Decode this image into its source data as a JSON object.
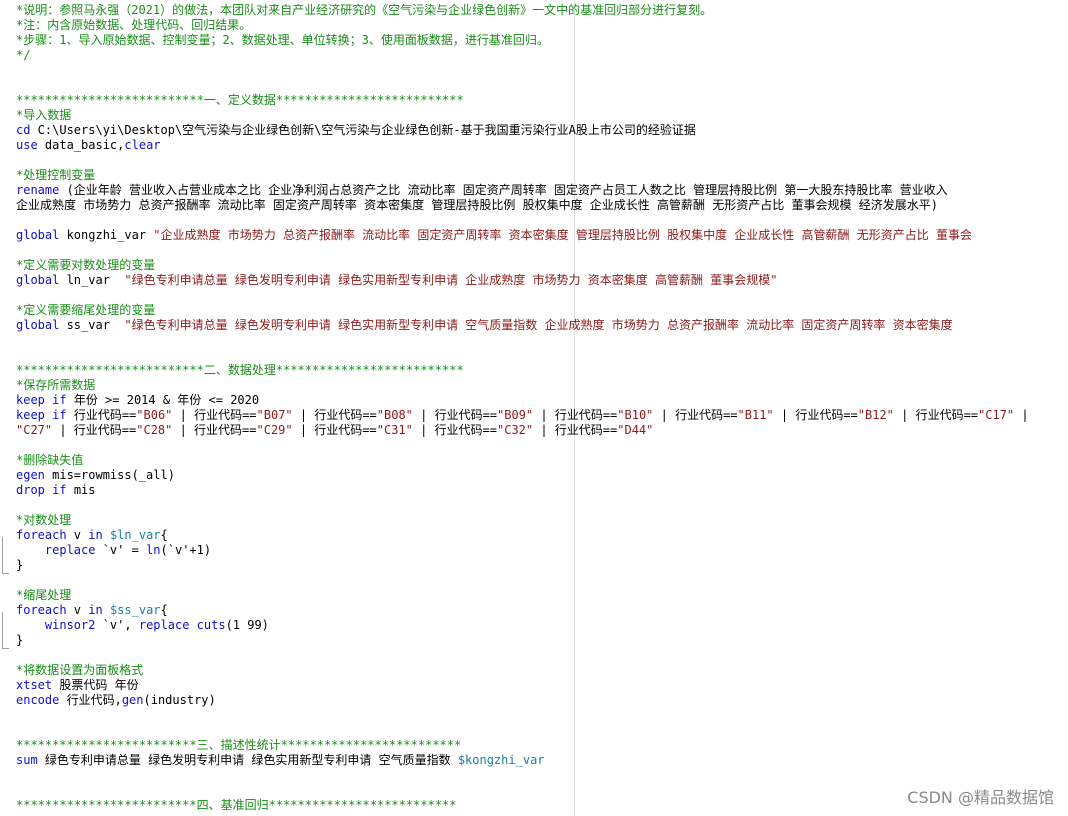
{
  "editor": {
    "lines": [
      "*说明：参照马永强（2021）的做法，本团队对来自产业经济研究的《空气污染与企业绿色创新》一文中的基准回归部分进行复刻。",
      "*注：内含原始数据、处理代码、回归结果。",
      "*步骤：1、导入原始数据、控制变量；2、数据处理、单位转换；3、使用面板数据，进行基准回归。",
      "*/",
      "",
      "",
      "**************************一、定义数据**************************",
      "*导入数据",
      "cd C:\\Users\\yi\\Desktop\\空气污染与企业绿色创新\\空气污染与企业绿色创新-基于我国重污染行业A股上市公司的经验证据",
      "use data_basic,clear",
      "",
      "*处理控制变量",
      "rename (企业年龄 营业收入占营业成本之比 企业净利润占总资产之比 流动比率 固定资产周转率 固定资产占员工人数之比 管理层持股比例 第一大股东持股比率 营业收入",
      "企业成熟度 市场势力 总资产报酬率 流动比率 固定资产周转率 资本密集度 管理层持股比例 股权集中度 企业成长性 高管薪酬 无形资产占比 董事会规模 经济发展水平)",
      "",
      "global kongzhi_var \"企业成熟度 市场势力 总资产报酬率 流动比率 固定资产周转率 资本密集度 管理层持股比例 股权集中度 企业成长性 高管薪酬 无形资产占比 董事会",
      "",
      "*定义需要对数处理的变量",
      "global ln_var  \"绿色专利申请总量 绿色发明专利申请 绿色实用新型专利申请 企业成熟度 市场势力 资本密集度 高管薪酬 董事会规模\"",
      "",
      "*定义需要缩尾处理的变量",
      "global ss_var  \"绿色专利申请总量 绿色发明专利申请 绿色实用新型专利申请 空气质量指数 企业成熟度 市场势力 总资产报酬率 流动比率 固定资产周转率 资本密集度",
      "",
      "",
      "**************************二、数据处理**************************",
      "*保存所需数据",
      "keep if 年份 >= 2014 & 年份 <= 2020",
      "keep if 行业代码==\"B06\" | 行业代码==\"B07\" | 行业代码==\"B08\" | 行业代码==\"B09\" | 行业代码==\"B10\" | 行业代码==\"B11\" | 行业代码==\"B12\" | 行业代码==\"C17\" |",
      "\"C27\" | 行业代码==\"C28\" | 行业代码==\"C29\" | 行业代码==\"C31\" | 行业代码==\"C32\" | 行业代码==\"D44\"",
      "",
      "*删除缺失值",
      "egen mis=rowmiss(_all)",
      "drop if mis",
      "",
      "*对数处理",
      "foreach v in $ln_var{",
      "    replace `v' = ln(`v'+1)",
      "}",
      "",
      "*缩尾处理",
      "foreach v in $ss_var{",
      "    winsor2 `v', replace cuts(1 99)",
      "}",
      "",
      "*将数据设置为面板格式",
      "xtset 股票代码 年份",
      "encode 行业代码,gen(industry)",
      "",
      "",
      "*************************三、描述性统计*************************",
      "sum 绿色专利申请总量 绿色发明专利申请 绿色实用新型专利申请 空气质量指数 $kongzhi_var",
      "",
      "",
      "*************************四、基准回归**************************"
    ],
    "watermark": "CSDN @精品数据馆"
  }
}
